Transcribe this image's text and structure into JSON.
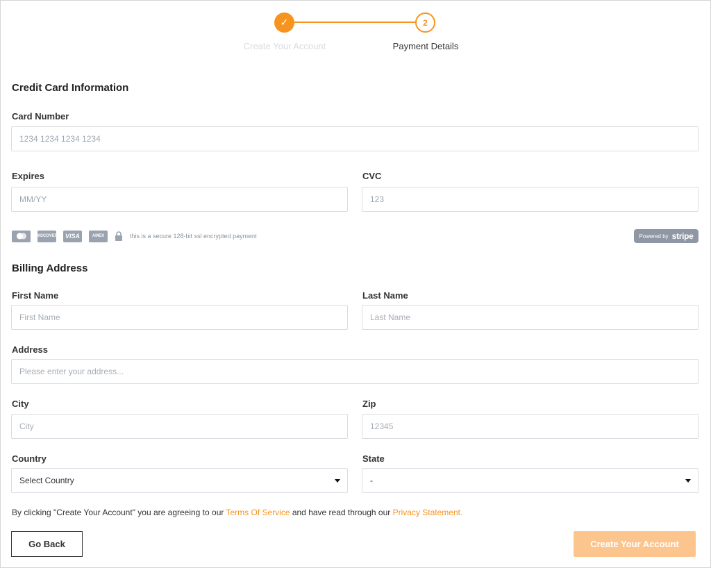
{
  "stepper": {
    "step1": {
      "number": "✓",
      "label": "Create Your Account"
    },
    "step2": {
      "number": "2",
      "label": "Payment Details"
    }
  },
  "card_section": {
    "title": "Credit Card Information",
    "card_number": {
      "label": "Card Number",
      "placeholder": "1234 1234 1234 1234"
    },
    "expires": {
      "label": "Expires",
      "placeholder": "MM/YY"
    },
    "cvc": {
      "label": "CVC",
      "placeholder": "123"
    },
    "card_brands": [
      "mastercard",
      "discover",
      "visa",
      "amex"
    ],
    "brand_text": {
      "discover": "DISCOVER",
      "visa": "VISA",
      "amex": "AMEX"
    },
    "secure_text": "this is a secure 128-bit ssl encrypted payment",
    "stripe": {
      "prefix": "Powered by",
      "brand": "stripe"
    }
  },
  "billing_section": {
    "title": "Billing Address",
    "first_name": {
      "label": "First Name",
      "placeholder": "First Name"
    },
    "last_name": {
      "label": "Last Name",
      "placeholder": "Last Name"
    },
    "address": {
      "label": "Address",
      "placeholder": "Please enter your address..."
    },
    "city": {
      "label": "City",
      "placeholder": "City"
    },
    "zip": {
      "label": "Zip",
      "placeholder": "12345"
    },
    "country": {
      "label": "Country",
      "value": "Select Country"
    },
    "state": {
      "label": "State",
      "value": "-"
    }
  },
  "agreement": {
    "text_before": "By clicking \"Create Your Account\" you are agreeing to our ",
    "terms_link": "Terms Of Service",
    "text_middle": " and have read through our ",
    "privacy_link": "Privacy Statement."
  },
  "buttons": {
    "back": "Go Back",
    "create": "Create Your Account"
  },
  "colors": {
    "accent": "#f7941d",
    "disabled_button": "#fbc58d"
  }
}
